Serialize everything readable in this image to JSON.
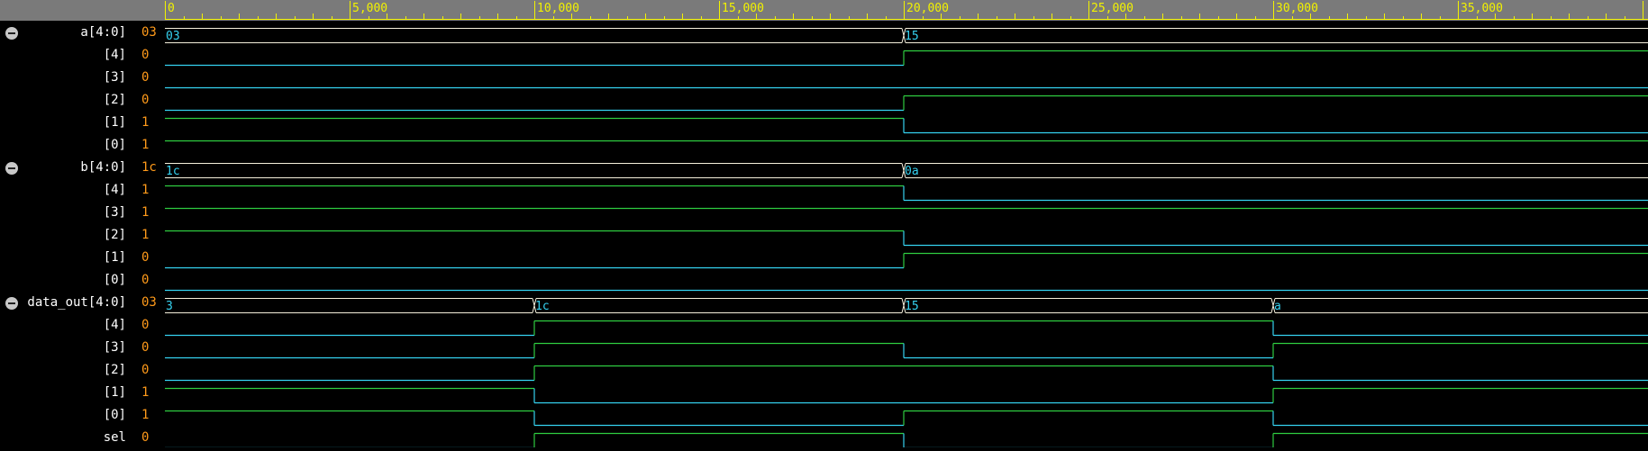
{
  "colors": {
    "background": "#000000",
    "ruler_bg": "#7a7a7a",
    "ruler_ticks": "#f2f200",
    "bit_high": "#2ecc40",
    "bit_low": "#35d2f0",
    "bus_line": "#f5f0dc",
    "bus_text": "#35d2f0",
    "signal_name": "#ffffff",
    "signal_value": "#ff9a1a"
  },
  "ruler": {
    "labels": [
      "0",
      "5,000",
      "10,000",
      "15,000",
      "20,000",
      "25,000",
      "30,000",
      "35,000"
    ],
    "label_times": [
      0,
      5000,
      10000,
      15000,
      20000,
      25000,
      30000,
      35000
    ],
    "time_end": 40000
  },
  "signals": [
    {
      "name": "a[4:0]",
      "value": "03",
      "bus": true,
      "group": true,
      "segments": [
        {
          "t": 0,
          "label": "03"
        },
        {
          "t": 20000,
          "label": "15"
        }
      ]
    },
    {
      "name": "[4]",
      "value": "0",
      "trans": [
        [
          0,
          0
        ],
        [
          20000,
          1
        ]
      ]
    },
    {
      "name": "[3]",
      "value": "0",
      "trans": [
        [
          0,
          0
        ]
      ]
    },
    {
      "name": "[2]",
      "value": "0",
      "trans": [
        [
          0,
          0
        ],
        [
          20000,
          1
        ]
      ]
    },
    {
      "name": "[1]",
      "value": "1",
      "trans": [
        [
          0,
          1
        ],
        [
          20000,
          0
        ]
      ]
    },
    {
      "name": "[0]",
      "value": "1",
      "trans": [
        [
          0,
          1
        ]
      ]
    },
    {
      "name": "b[4:0]",
      "value": "1c",
      "bus": true,
      "group": true,
      "segments": [
        {
          "t": 0,
          "label": "1c"
        },
        {
          "t": 20000,
          "label": "0a"
        }
      ]
    },
    {
      "name": "[4]",
      "value": "1",
      "trans": [
        [
          0,
          1
        ],
        [
          20000,
          0
        ]
      ]
    },
    {
      "name": "[3]",
      "value": "1",
      "trans": [
        [
          0,
          1
        ]
      ]
    },
    {
      "name": "[2]",
      "value": "1",
      "trans": [
        [
          0,
          1
        ],
        [
          20000,
          0
        ]
      ]
    },
    {
      "name": "[1]",
      "value": "0",
      "trans": [
        [
          0,
          0
        ],
        [
          20000,
          1
        ]
      ]
    },
    {
      "name": "[0]",
      "value": "0",
      "trans": [
        [
          0,
          0
        ]
      ]
    },
    {
      "name": "data_out[4:0]",
      "value": "03",
      "bus": true,
      "group": true,
      "segments": [
        {
          "t": 0,
          "label": "3"
        },
        {
          "t": 10000,
          "label": "1c"
        },
        {
          "t": 20000,
          "label": "15"
        },
        {
          "t": 30000,
          "label": "a"
        }
      ]
    },
    {
      "name": "[4]",
      "value": "0",
      "trans": [
        [
          0,
          0
        ],
        [
          10000,
          1
        ],
        [
          30000,
          0
        ]
      ]
    },
    {
      "name": "[3]",
      "value": "0",
      "trans": [
        [
          0,
          0
        ],
        [
          10000,
          1
        ],
        [
          20000,
          0
        ],
        [
          30000,
          1
        ]
      ]
    },
    {
      "name": "[2]",
      "value": "0",
      "trans": [
        [
          0,
          0
        ],
        [
          10000,
          1
        ],
        [
          30000,
          0
        ]
      ]
    },
    {
      "name": "[1]",
      "value": "1",
      "trans": [
        [
          0,
          1
        ],
        [
          10000,
          0
        ],
        [
          30000,
          1
        ]
      ]
    },
    {
      "name": "[0]",
      "value": "1",
      "trans": [
        [
          0,
          1
        ],
        [
          10000,
          0
        ],
        [
          20000,
          1
        ],
        [
          30000,
          0
        ]
      ]
    },
    {
      "name": "sel",
      "value": "0",
      "trans": [
        [
          0,
          0
        ],
        [
          10000,
          1
        ],
        [
          20000,
          0
        ],
        [
          30000,
          1
        ]
      ]
    }
  ]
}
